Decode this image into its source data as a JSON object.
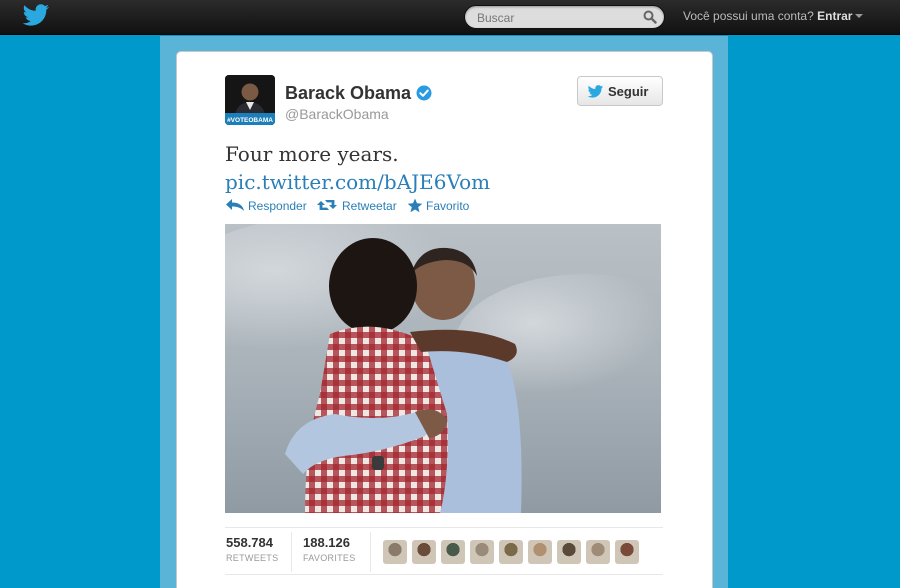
{
  "topbar": {
    "logo_icon": "twitter-bird-icon",
    "search_placeholder": "Buscar",
    "search_icon": "magnifier-icon",
    "signin_prompt": "Você possui uma conta?",
    "signin_label": "Entrar"
  },
  "tweet": {
    "name": "Barack Obama",
    "handle": "@BarackObama",
    "avatar_badge": "#VOTEOBAMA",
    "verified_icon": "verified-badge-icon",
    "follow_label": "Seguir",
    "text": "Four more years.",
    "link": "pic.twitter.com/bAJE6Vom",
    "actions": [
      {
        "label": "Responder",
        "icon": "reply-icon"
      },
      {
        "label": "Retweetar",
        "icon": "retweet-icon"
      },
      {
        "label": "Favorito",
        "icon": "star-icon"
      }
    ],
    "stats": {
      "retweets_count": "558.784",
      "retweets_label": "RETWEETS",
      "favorites_count": "188.126",
      "favorites_label": "FAVORITES"
    },
    "favoriters_count": 9
  },
  "colors": {
    "accent_link": "#2a7fb8",
    "page_background": "#0099cc",
    "topbar": "#1f1f1f",
    "verified": "#2a9be0"
  }
}
